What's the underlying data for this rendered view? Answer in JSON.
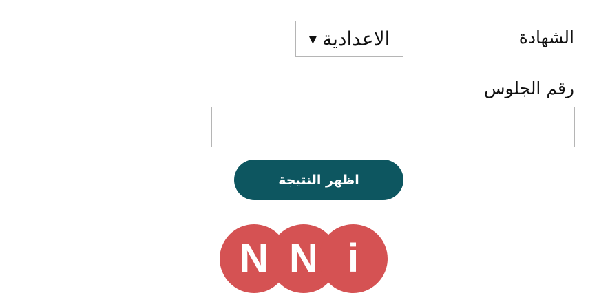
{
  "form": {
    "certificate_label": "الشهادة",
    "certificate_selected": "الاعدادية",
    "seat_label": "رقم الجلوس",
    "seat_value": "",
    "submit_label": "اظهر النتيجة"
  },
  "logo": {
    "letters": [
      "N",
      "N",
      "i"
    ],
    "color": "#d55253"
  },
  "colors": {
    "button": "#0d5660"
  }
}
